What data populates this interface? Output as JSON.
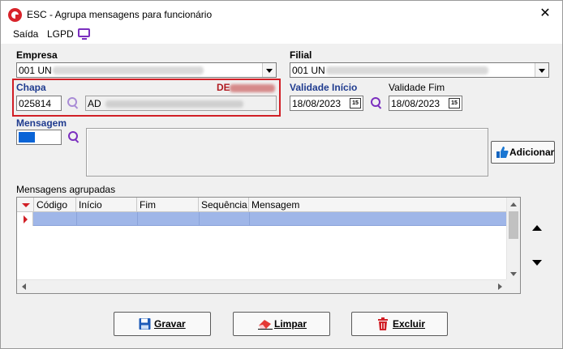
{
  "window": {
    "title": "ESC - Agrupa mensagens para funcionário",
    "close_label": "✕"
  },
  "menu": {
    "items": [
      "Saída",
      "LGPD"
    ]
  },
  "form": {
    "empresa": {
      "label": "Empresa",
      "value": "001 UN"
    },
    "filial": {
      "label": "Filial",
      "value": "001 UN"
    },
    "chapa": {
      "label": "Chapa",
      "value": "025814",
      "name_value": "AD",
      "right_label": "DE"
    },
    "validade_inicio": {
      "label": "Validade Início",
      "value": "18/08/2023"
    },
    "validade_fim": {
      "label": "Validade Fim",
      "value": "18/08/2023"
    },
    "mensagem": {
      "label": "Mensagem"
    },
    "calendar_glyph": "15"
  },
  "buttons": {
    "adicionar": "Adicionar",
    "gravar": "Gravar",
    "limpar": "Limpar",
    "excluir": "Excluir"
  },
  "grid": {
    "title": "Mensagens agrupadas",
    "columns": [
      "Código",
      "Início",
      "Fim",
      "Sequência",
      "Mensagem"
    ],
    "rows": []
  },
  "colors": {
    "accent_blue": "#1f3b8f",
    "highlight_red": "#d11f26",
    "icon_purple": "#7b2fbf",
    "selected_row": "#9fb6e8"
  }
}
